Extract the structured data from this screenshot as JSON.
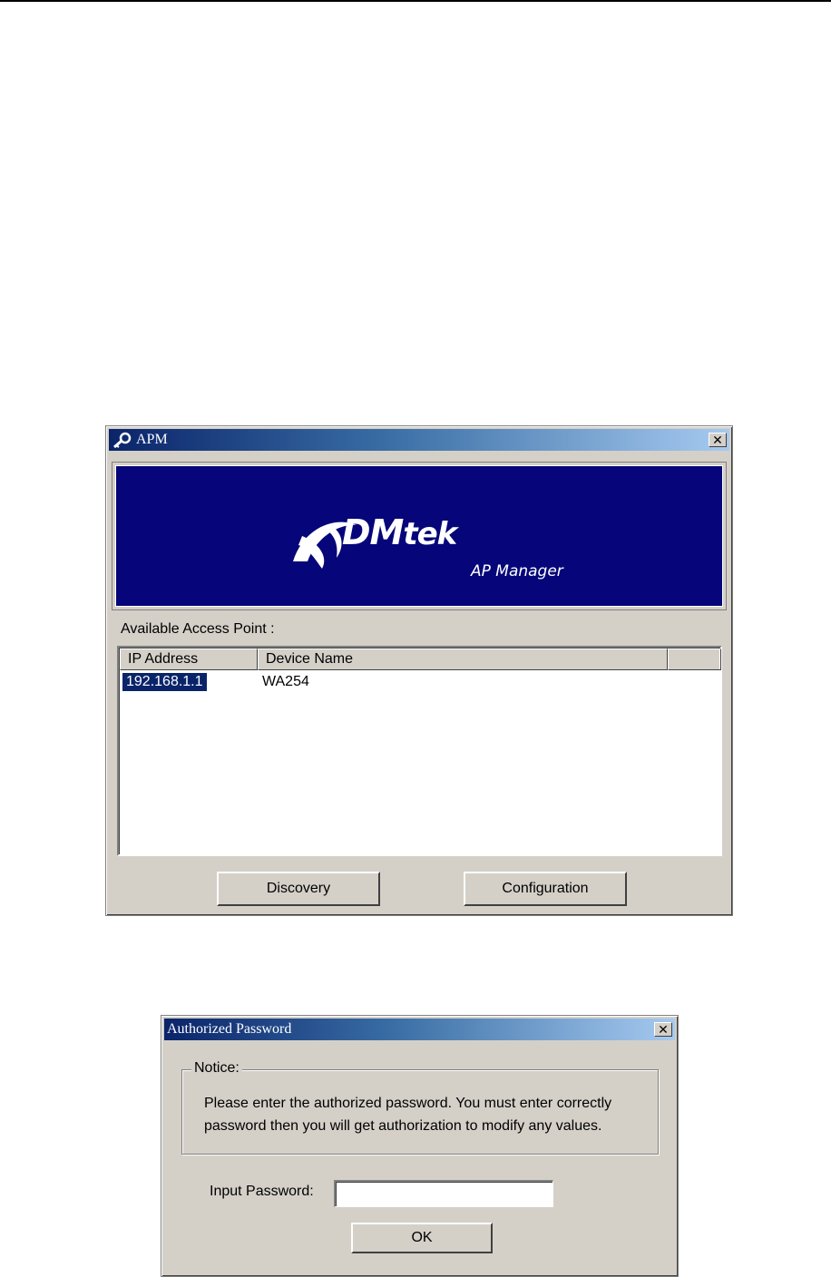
{
  "apm": {
    "title": "APM",
    "close": "✕",
    "brand_letter_a": "A",
    "brand_upper": "DM",
    "brand_lower": "tek",
    "brand_sub": "AP Manager",
    "available_label": "Available Access Point :",
    "columns": [
      "IP Address",
      "Device Name",
      ""
    ],
    "rows": [
      {
        "ip": "192.168.1.1",
        "name": "WA254"
      }
    ],
    "discovery_label": "Discovery",
    "configuration_label": "Configuration"
  },
  "password_dialog": {
    "title": "Authorized Password",
    "close": "✕",
    "notice_legend": "Notice:",
    "notice_text": "Please enter the authorized password. You must enter correctly password then you will get authorization to modify any values.",
    "input_label": "Input Password:",
    "input_value": "",
    "ok_label": "OK"
  },
  "colors": {
    "title_gradient_start": "#0a246a",
    "title_gradient_end": "#a6caf0",
    "banner_bg": "#06067a",
    "window_face": "#d4d0c8",
    "selection": "#0a246a"
  }
}
